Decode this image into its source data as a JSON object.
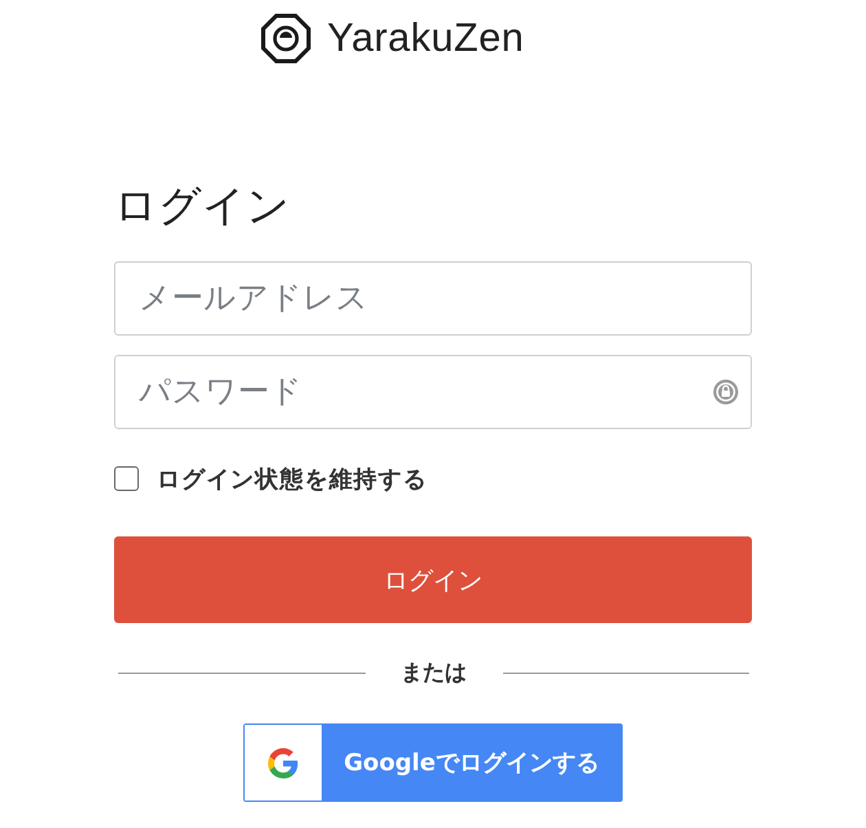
{
  "logo": {
    "text": "YarakuZen"
  },
  "heading": "ログイン",
  "fields": [
    {
      "kind": "email",
      "placeholder": "メールアドレス"
    },
    {
      "kind": "password",
      "placeholder": "パスワード"
    }
  ],
  "remember": {
    "label": "ログイン状態を維持する",
    "checked": false
  },
  "login_button": "ログイン",
  "divider": "または",
  "google_button": "Googleでログインする"
}
